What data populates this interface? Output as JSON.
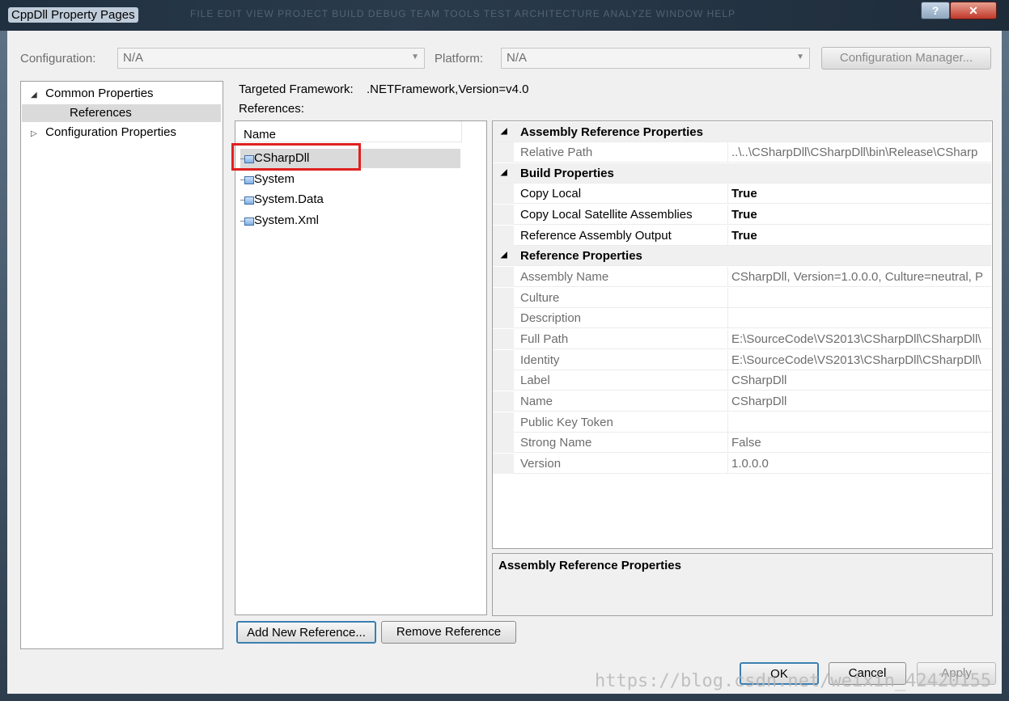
{
  "window": {
    "title": "CppDll Property Pages",
    "blurred_menu": "FILE  EDIT  VIEW  PROJECT  BUILD  DEBUG  TEAM  TOOLS  TEST  ARCHITECTURE  ANALYZE  WINDOW  HELP"
  },
  "titlebar_buttons": {
    "help": "?",
    "close": "✕"
  },
  "toolbar": {
    "configuration_label": "Configuration:",
    "configuration_value": "N/A",
    "platform_label": "Platform:",
    "platform_value": "N/A",
    "config_manager": "Configuration Manager..."
  },
  "tree": {
    "items": [
      {
        "label": "Common Properties",
        "expander": "◢"
      },
      {
        "label": "References"
      },
      {
        "label": "Configuration Properties",
        "expander": "▷"
      }
    ]
  },
  "main": {
    "framework_label": "Targeted Framework:",
    "framework_value": ".NETFramework,Version=v4.0",
    "references_label": "References:",
    "column_name": "Name",
    "references": [
      "CSharpDll",
      "System",
      "System.Data",
      "System.Xml"
    ]
  },
  "grid": {
    "categories": {
      "assembly": "Assembly Reference Properties",
      "build": "Build Properties",
      "reference": "Reference Properties"
    },
    "rows": {
      "relative_path": {
        "name": "Relative Path",
        "value": "..\\..\\CSharpDll\\CSharpDll\\bin\\Release\\CSharp"
      },
      "copy_local": {
        "name": "Copy Local",
        "value": "True"
      },
      "copy_local_sat": {
        "name": "Copy Local Satellite Assemblies",
        "value": "True"
      },
      "ref_asm_output": {
        "name": "Reference Assembly Output",
        "value": "True"
      },
      "assembly_name": {
        "name": "Assembly Name",
        "value": "CSharpDll, Version=1.0.0.0, Culture=neutral, P"
      },
      "culture": {
        "name": "Culture",
        "value": ""
      },
      "description": {
        "name": "Description",
        "value": ""
      },
      "full_path": {
        "name": "Full Path",
        "value": "E:\\SourceCode\\VS2013\\CSharpDll\\CSharpDll\\"
      },
      "identity": {
        "name": "Identity",
        "value": "E:\\SourceCode\\VS2013\\CSharpDll\\CSharpDll\\"
      },
      "label": {
        "name": "Label",
        "value": "CSharpDll"
      },
      "name": {
        "name": "Name",
        "value": "CSharpDll"
      },
      "public_key_token": {
        "name": "Public Key Token",
        "value": ""
      },
      "strong_name": {
        "name": "Strong Name",
        "value": "False"
      },
      "version": {
        "name": "Version",
        "value": "1.0.0.0"
      }
    }
  },
  "description_panel": {
    "title": "Assembly Reference Properties"
  },
  "buttons": {
    "add_reference": "Add New Reference...",
    "remove_reference": "Remove Reference",
    "ok": "OK",
    "cancel": "Cancel",
    "apply": "Apply"
  },
  "watermark": "https://blog.csdn.net/weixin_42420155",
  "colors": {
    "highlight_box": "#e02020",
    "selection": "#dadada"
  }
}
